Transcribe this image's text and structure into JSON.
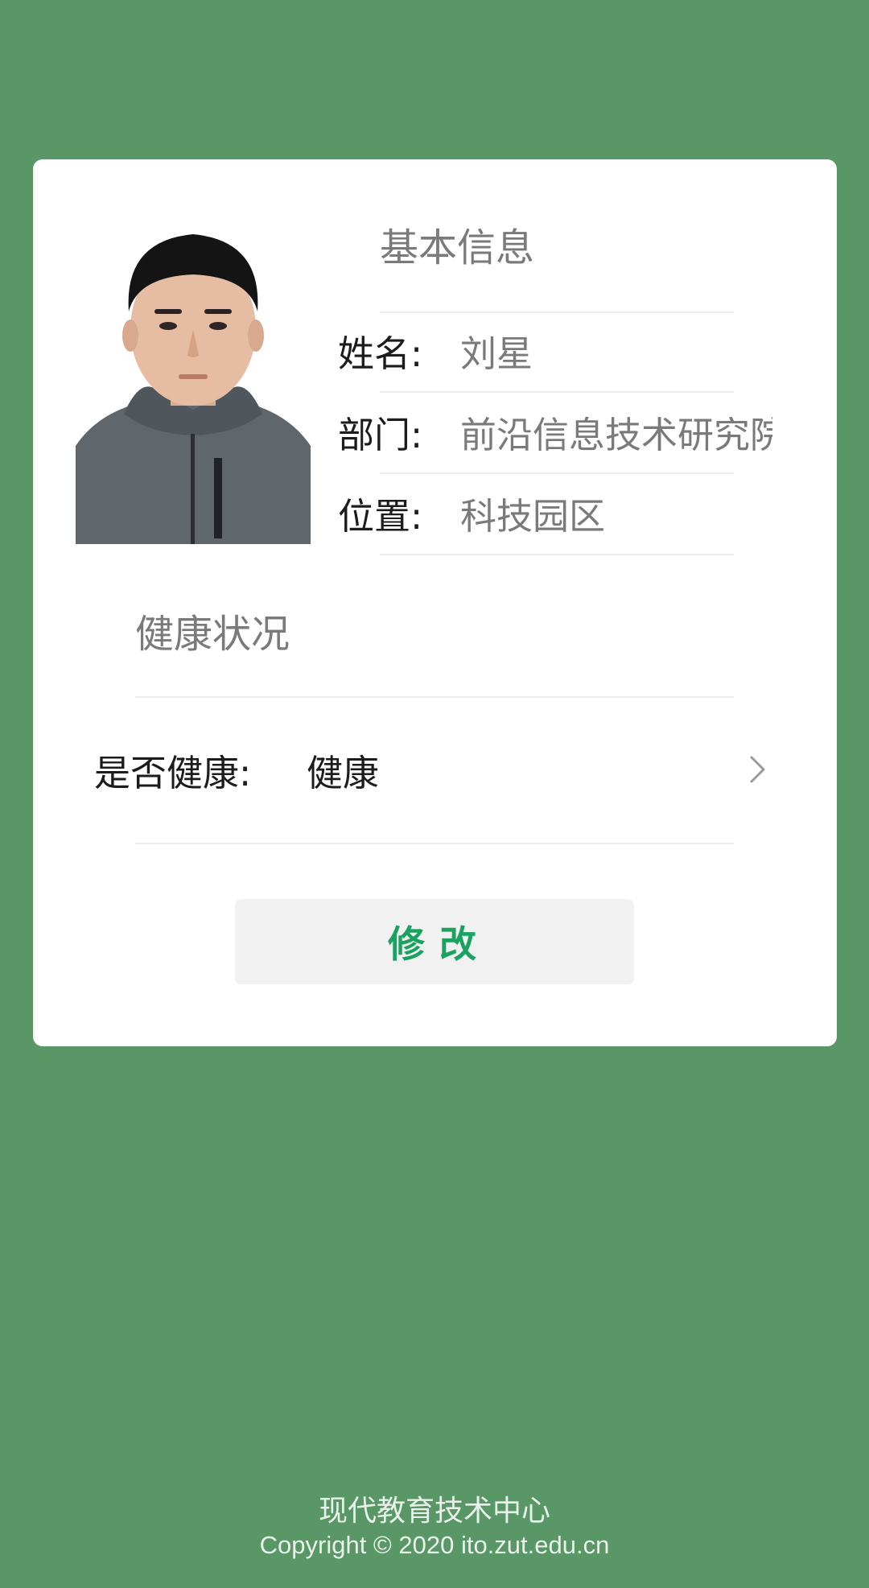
{
  "profile": {
    "photo_alt": "avatar-photo"
  },
  "basic_info": {
    "title": "基本信息",
    "name_label": "姓名:",
    "name_value": "刘星",
    "dept_label": "部门:",
    "dept_value": "前沿信息技术研究院",
    "location_label": "位置:",
    "location_value": "科技园区"
  },
  "health": {
    "title": "健康状况",
    "status_label": "是否健康:",
    "status_value": "健康"
  },
  "actions": {
    "edit_label": "修改"
  },
  "footer": {
    "org": "现代教育技术中心",
    "copyright": "Copyright © 2020 ito.zut.edu.cn"
  },
  "colors": {
    "page_background": "#5a9766",
    "accent": "#1aa260",
    "card": "#ffffff"
  },
  "icons": {
    "row_arrow": "chevron-right-icon"
  }
}
